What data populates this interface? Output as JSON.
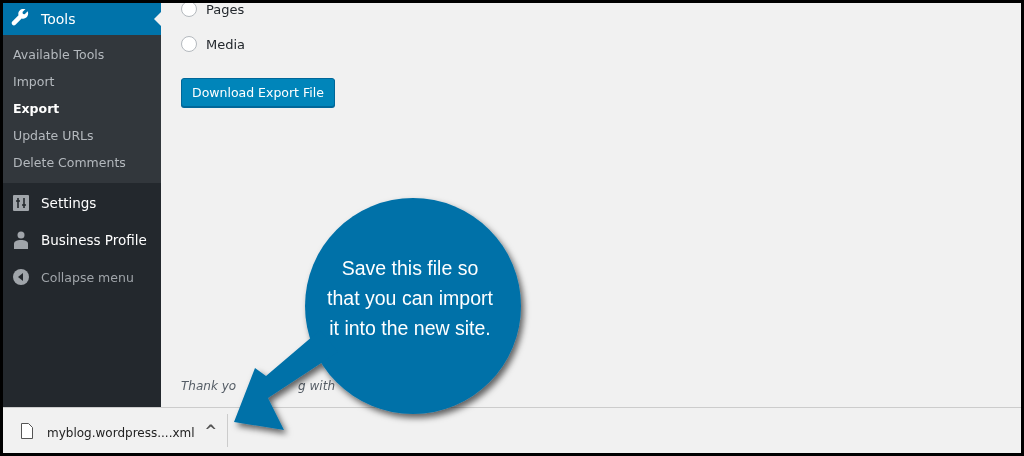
{
  "sidebar": {
    "active_menu": {
      "label": "Tools",
      "selected": true
    },
    "submenu": [
      {
        "label": "Available Tools",
        "selected": false
      },
      {
        "label": "Import",
        "selected": false
      },
      {
        "label": "Export",
        "selected": true
      },
      {
        "label": "Update URLs",
        "selected": false
      },
      {
        "label": "Delete Comments",
        "selected": false
      }
    ],
    "menu": [
      {
        "label": "Settings",
        "kind": "settings"
      },
      {
        "label": "Business Profile",
        "kind": "profile"
      },
      {
        "label": "Collapse menu",
        "kind": "collapse"
      }
    ]
  },
  "content": {
    "options": [
      {
        "label": "Pages",
        "selected": false
      },
      {
        "label": "Media",
        "selected": false
      }
    ],
    "button": "Download Export File",
    "footer": [
      "Thank yo",
      "g with"
    ]
  },
  "callout": {
    "text": "Save this file so that you can import it into the new site."
  },
  "download_bar": {
    "file": "myblog.wordpress....xml",
    "caret": "^"
  }
}
